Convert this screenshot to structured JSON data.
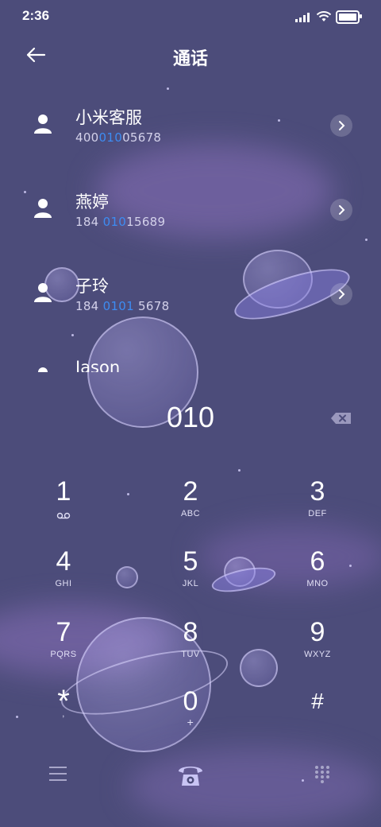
{
  "status_bar": {
    "time": "2:36"
  },
  "header": {
    "title": "通话"
  },
  "contacts": [
    {
      "name": "小米客服",
      "number_pre": "400",
      "number_hl": "010",
      "number_post": "05678"
    },
    {
      "name": "燕婷",
      "number_pre": "184 ",
      "number_hl": "010",
      "number_post": "15689"
    },
    {
      "name": "子玲",
      "number_pre": "184 ",
      "number_hl": "0101",
      "number_post": " 5678"
    },
    {
      "name": "Jason",
      "number_pre": "",
      "number_hl": "",
      "number_post": ""
    }
  ],
  "dialer": {
    "input": "010"
  },
  "keypad": [
    {
      "digit": "1",
      "letters": ""
    },
    {
      "digit": "2",
      "letters": "ABC"
    },
    {
      "digit": "3",
      "letters": "DEF"
    },
    {
      "digit": "4",
      "letters": "GHI"
    },
    {
      "digit": "5",
      "letters": "JKL"
    },
    {
      "digit": "6",
      "letters": "MNO"
    },
    {
      "digit": "7",
      "letters": "PQRS"
    },
    {
      "digit": "8",
      "letters": "TUV"
    },
    {
      "digit": "9",
      "letters": "WXYZ"
    },
    {
      "digit": "*",
      "letters": ","
    },
    {
      "digit": "0",
      "letters": "+"
    },
    {
      "digit": "#",
      "letters": ""
    }
  ],
  "icons": {
    "back": "back-arrow-icon",
    "avatar": "person-icon",
    "chevron": "chevron-right-icon",
    "backspace": "backspace-icon",
    "voicemail": "voicemail-icon",
    "menu": "menu-icon",
    "call": "call-icon",
    "dialpad": "dialpad-icon"
  },
  "colors": {
    "background": "#4c4c7a",
    "highlight": "#3d8cf2",
    "accent": "#c9c4f4"
  }
}
